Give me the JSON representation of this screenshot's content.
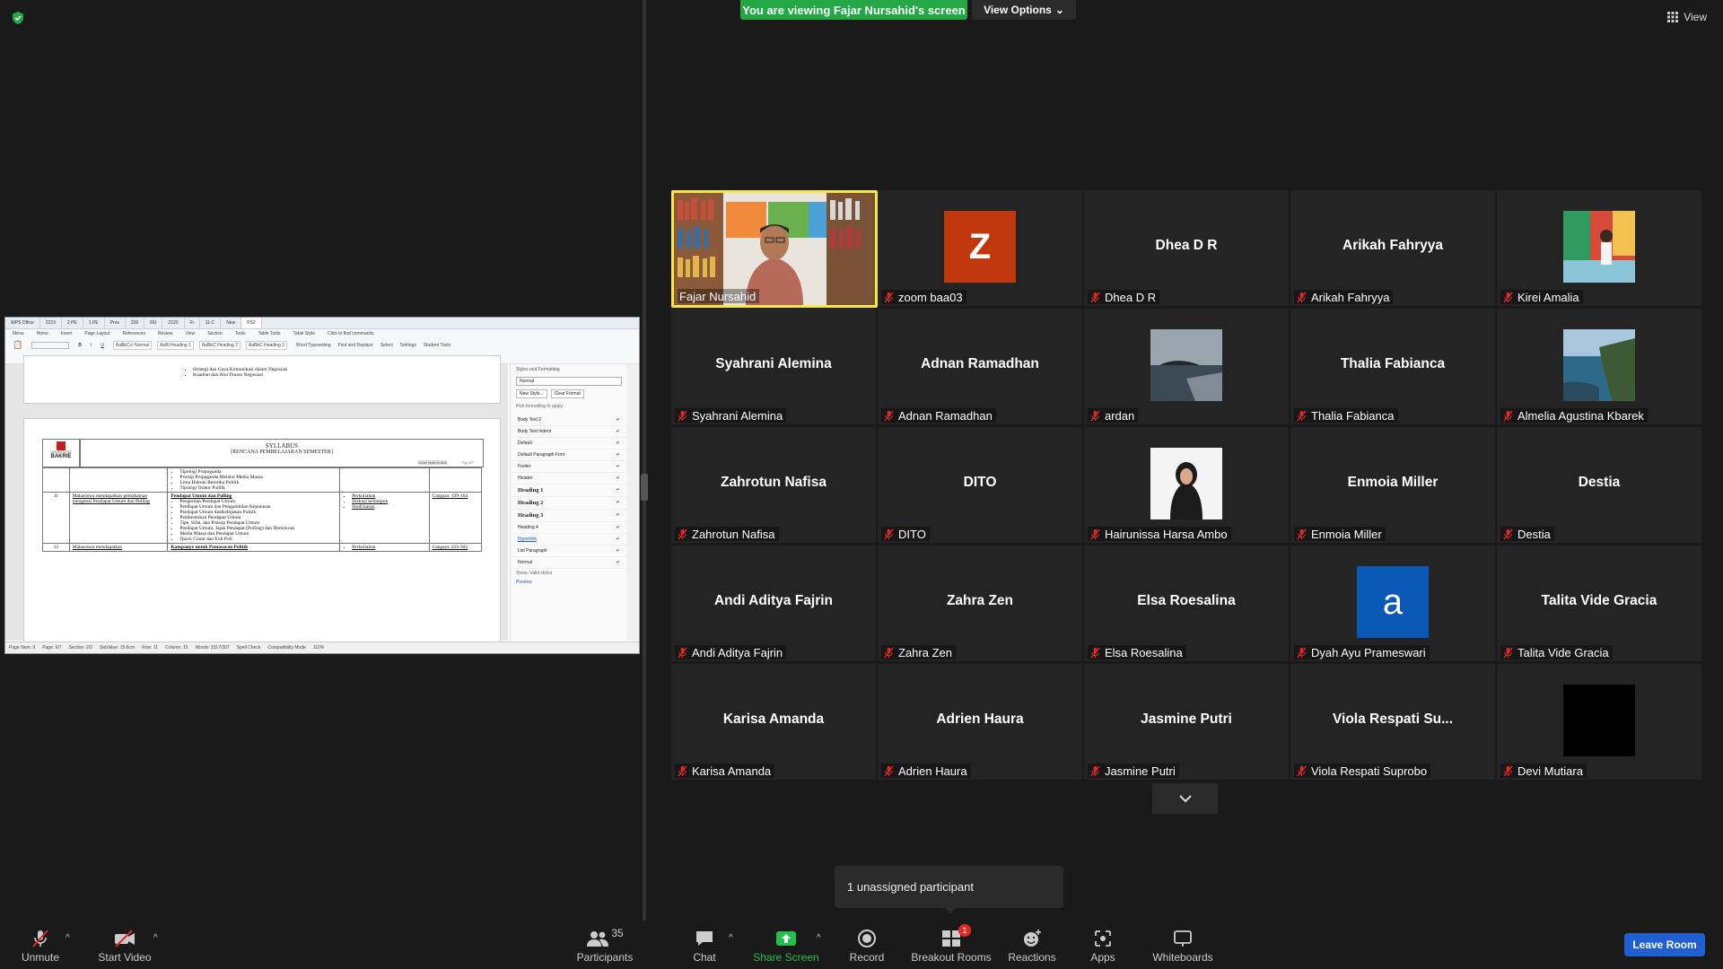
{
  "banner": {
    "viewing_text": "You are viewing Fajar Nursahid's screen",
    "view_options": "View Options",
    "view_toggle": "View"
  },
  "shared_doc": {
    "tabs": [
      "WPS Office",
      "2223",
      "2 PE",
      "1 PE",
      "Pres",
      "226",
      "RU",
      "2223",
      "Fi",
      "11-C",
      "New",
      "PS2"
    ],
    "menu": [
      "Menu",
      "Home",
      "Insert",
      "Page Layout",
      "References",
      "Review",
      "View",
      "Section",
      "Tools",
      "Table Tools",
      "Table Style",
      "Click to find commands"
    ],
    "styles": [
      "AaBbCcI Normal",
      "AaBl Heading 1",
      "AaBbC Heading 2",
      "AaBbC Heading 3"
    ],
    "tools": [
      "Word Typesetting",
      "Find and Replace",
      "Select",
      "Settings",
      "Student Tools"
    ],
    "side_panel": {
      "title": "Styles and Formatting",
      "current": "Normal",
      "buttons": [
        "New Style...",
        "Clear Format"
      ],
      "hint": "Pick formatting to apply",
      "items": [
        "Body Text 2",
        "Body Text Indent",
        "Default",
        "Default Paragraph Font",
        "Footer",
        "Header",
        "Heading 1",
        "Heading 2",
        "Heading 3",
        "Heading 4",
        "Hyperlink",
        "List Paragraph",
        "Normal"
      ],
      "show_label": "Show: Valid styles",
      "preview_label": "Preview"
    },
    "top_bullets": [
      "Strategi dan Gaya Komunikasi dalam Negosiasi",
      "Kuadran dan Alur Proses Negosiasi"
    ],
    "page": {
      "logo_top": "UNIVERSITAS",
      "logo_bottom": "BAKRIE",
      "title": "SYLLABUS",
      "subtitle": "[RENCANA PEMBELAJARAN SEMESTER]",
      "code": "Kode Mata Kuliah",
      "pg": "Pg. 6/7"
    },
    "rows": [
      {
        "no": "",
        "objective": "",
        "topics_head": "",
        "topics": [
          "Tipologi Propaganda",
          "Prinsip Propaganda Melalui Media Massa",
          "Lima Hukum Retorika Politik",
          "Tipologi Orator Politik"
        ],
        "method": [],
        "ref": ""
      },
      {
        "no": "11",
        "objective": "Mahasiswa mendapatkan pemahaman mengenai Pendapat Umum dan Polling",
        "topics_head": "Pendapat Umum dan Polling",
        "topics": [
          "Pengertian Pendapat Umum",
          "Pendapat Umum dan Pengambilan Keputusan",
          "Pendapat Umum danKebijakan Politik",
          "Pembentukan Pendapat Umum",
          "Tipe, Sifat, dan Prinsip Pendapat Umum",
          "Pendapat Umum, Jajak Pendapat (Polling) dan Demokrasi",
          "Media Massa dan Pendapat Umum",
          "Quick Count dan Exit Poll"
        ],
        "method": [
          "Perkuliahan",
          "Diskusi kelompok",
          "Studi kasus"
        ],
        "ref": "Cangara: 129-164"
      },
      {
        "no": "12",
        "objective": "Mahasiswa mendapatkan",
        "topics_head": "Kampanye untuk Pemasaran Politik",
        "topics": [],
        "method": [
          "Perkuliahan"
        ],
        "ref": "Cangara: 223-302"
      }
    ],
    "status": [
      "Page Num: 9",
      "Page: 6/7",
      "Section: 2/2",
      "SetValue: 15.6cm",
      "Row: 11",
      "Column: 15",
      "Words: 3317/307",
      "Spell Check",
      "Compatibility Mode",
      "110%"
    ]
  },
  "tiles": [
    {
      "name": "Fajar Nursahid",
      "kind": "video",
      "muted": false,
      "active_speaker": true
    },
    {
      "name": "zoom baa03",
      "kind": "letter",
      "letter": "Z",
      "color": "#c1380f",
      "muted": true
    },
    {
      "name": "Dhea D R",
      "kind": "name",
      "muted": true
    },
    {
      "name": "Arikah Fahryya",
      "kind": "name",
      "muted": true
    },
    {
      "name": "Kirei Amalia",
      "kind": "photo",
      "photo": "colorful-street",
      "muted": true
    },
    {
      "name": "Syahrani Alemina",
      "kind": "name",
      "muted": true
    },
    {
      "name": "Adnan Ramadhan",
      "kind": "name",
      "muted": true
    },
    {
      "name": "ardan",
      "kind": "photo",
      "photo": "sea-island",
      "muted": true
    },
    {
      "name": "Thalia Fabianca",
      "kind": "name",
      "muted": true
    },
    {
      "name": "Almelia Agustina Kbarek",
      "kind": "photo",
      "photo": "coast-cliff",
      "muted": true
    },
    {
      "name": "Zahrotun Nafisa",
      "kind": "name",
      "muted": true
    },
    {
      "name": "DITO",
      "kind": "name",
      "muted": true
    },
    {
      "name": "Hairunissa Harsa Ambo",
      "kind": "photo",
      "photo": "portrait",
      "muted": true
    },
    {
      "name": "Enmoia Miller",
      "kind": "name",
      "muted": true
    },
    {
      "name": "Destia",
      "kind": "name",
      "muted": true
    },
    {
      "name": "Andi Aditya Fajrin",
      "kind": "name",
      "muted": true
    },
    {
      "name": "Zahra Zen",
      "kind": "name",
      "muted": true
    },
    {
      "name": "Elsa Roesalina",
      "kind": "name",
      "muted": true
    },
    {
      "name": "Dyah Ayu Prameswari",
      "kind": "letter",
      "letter": "a",
      "color": "#0a58b5",
      "muted": true
    },
    {
      "name": "Talita Vide Gracia",
      "kind": "name",
      "muted": true
    },
    {
      "name": "Karisa Amanda",
      "kind": "name",
      "muted": true
    },
    {
      "name": "Adrien Haura",
      "kind": "name",
      "muted": true
    },
    {
      "name": "Jasmine Putri",
      "kind": "name",
      "muted": true
    },
    {
      "name": "Viola Respati Suprobo",
      "display_center": "Viola Respati Su...",
      "kind": "name",
      "muted": true
    },
    {
      "name": "Devi Mutiara",
      "kind": "black",
      "muted": true
    }
  ],
  "unassigned": "1 unassigned participant",
  "toolbar": {
    "unmute": "Unmute",
    "start_video": "Start Video",
    "participants": "Participants",
    "participants_count": "35",
    "chat": "Chat",
    "share_screen": "Share Screen",
    "record": "Record",
    "breakout_rooms": "Breakout Rooms",
    "breakout_badge": "1",
    "reactions": "Reactions",
    "apps": "Apps",
    "whiteboards": "Whiteboards",
    "leave_room": "Leave Room"
  },
  "colors": {
    "accent_green": "#23a845",
    "leave_blue": "#1f5fd1",
    "muted_red": "#e02828",
    "speaker_yellow": "#f6e84b"
  }
}
